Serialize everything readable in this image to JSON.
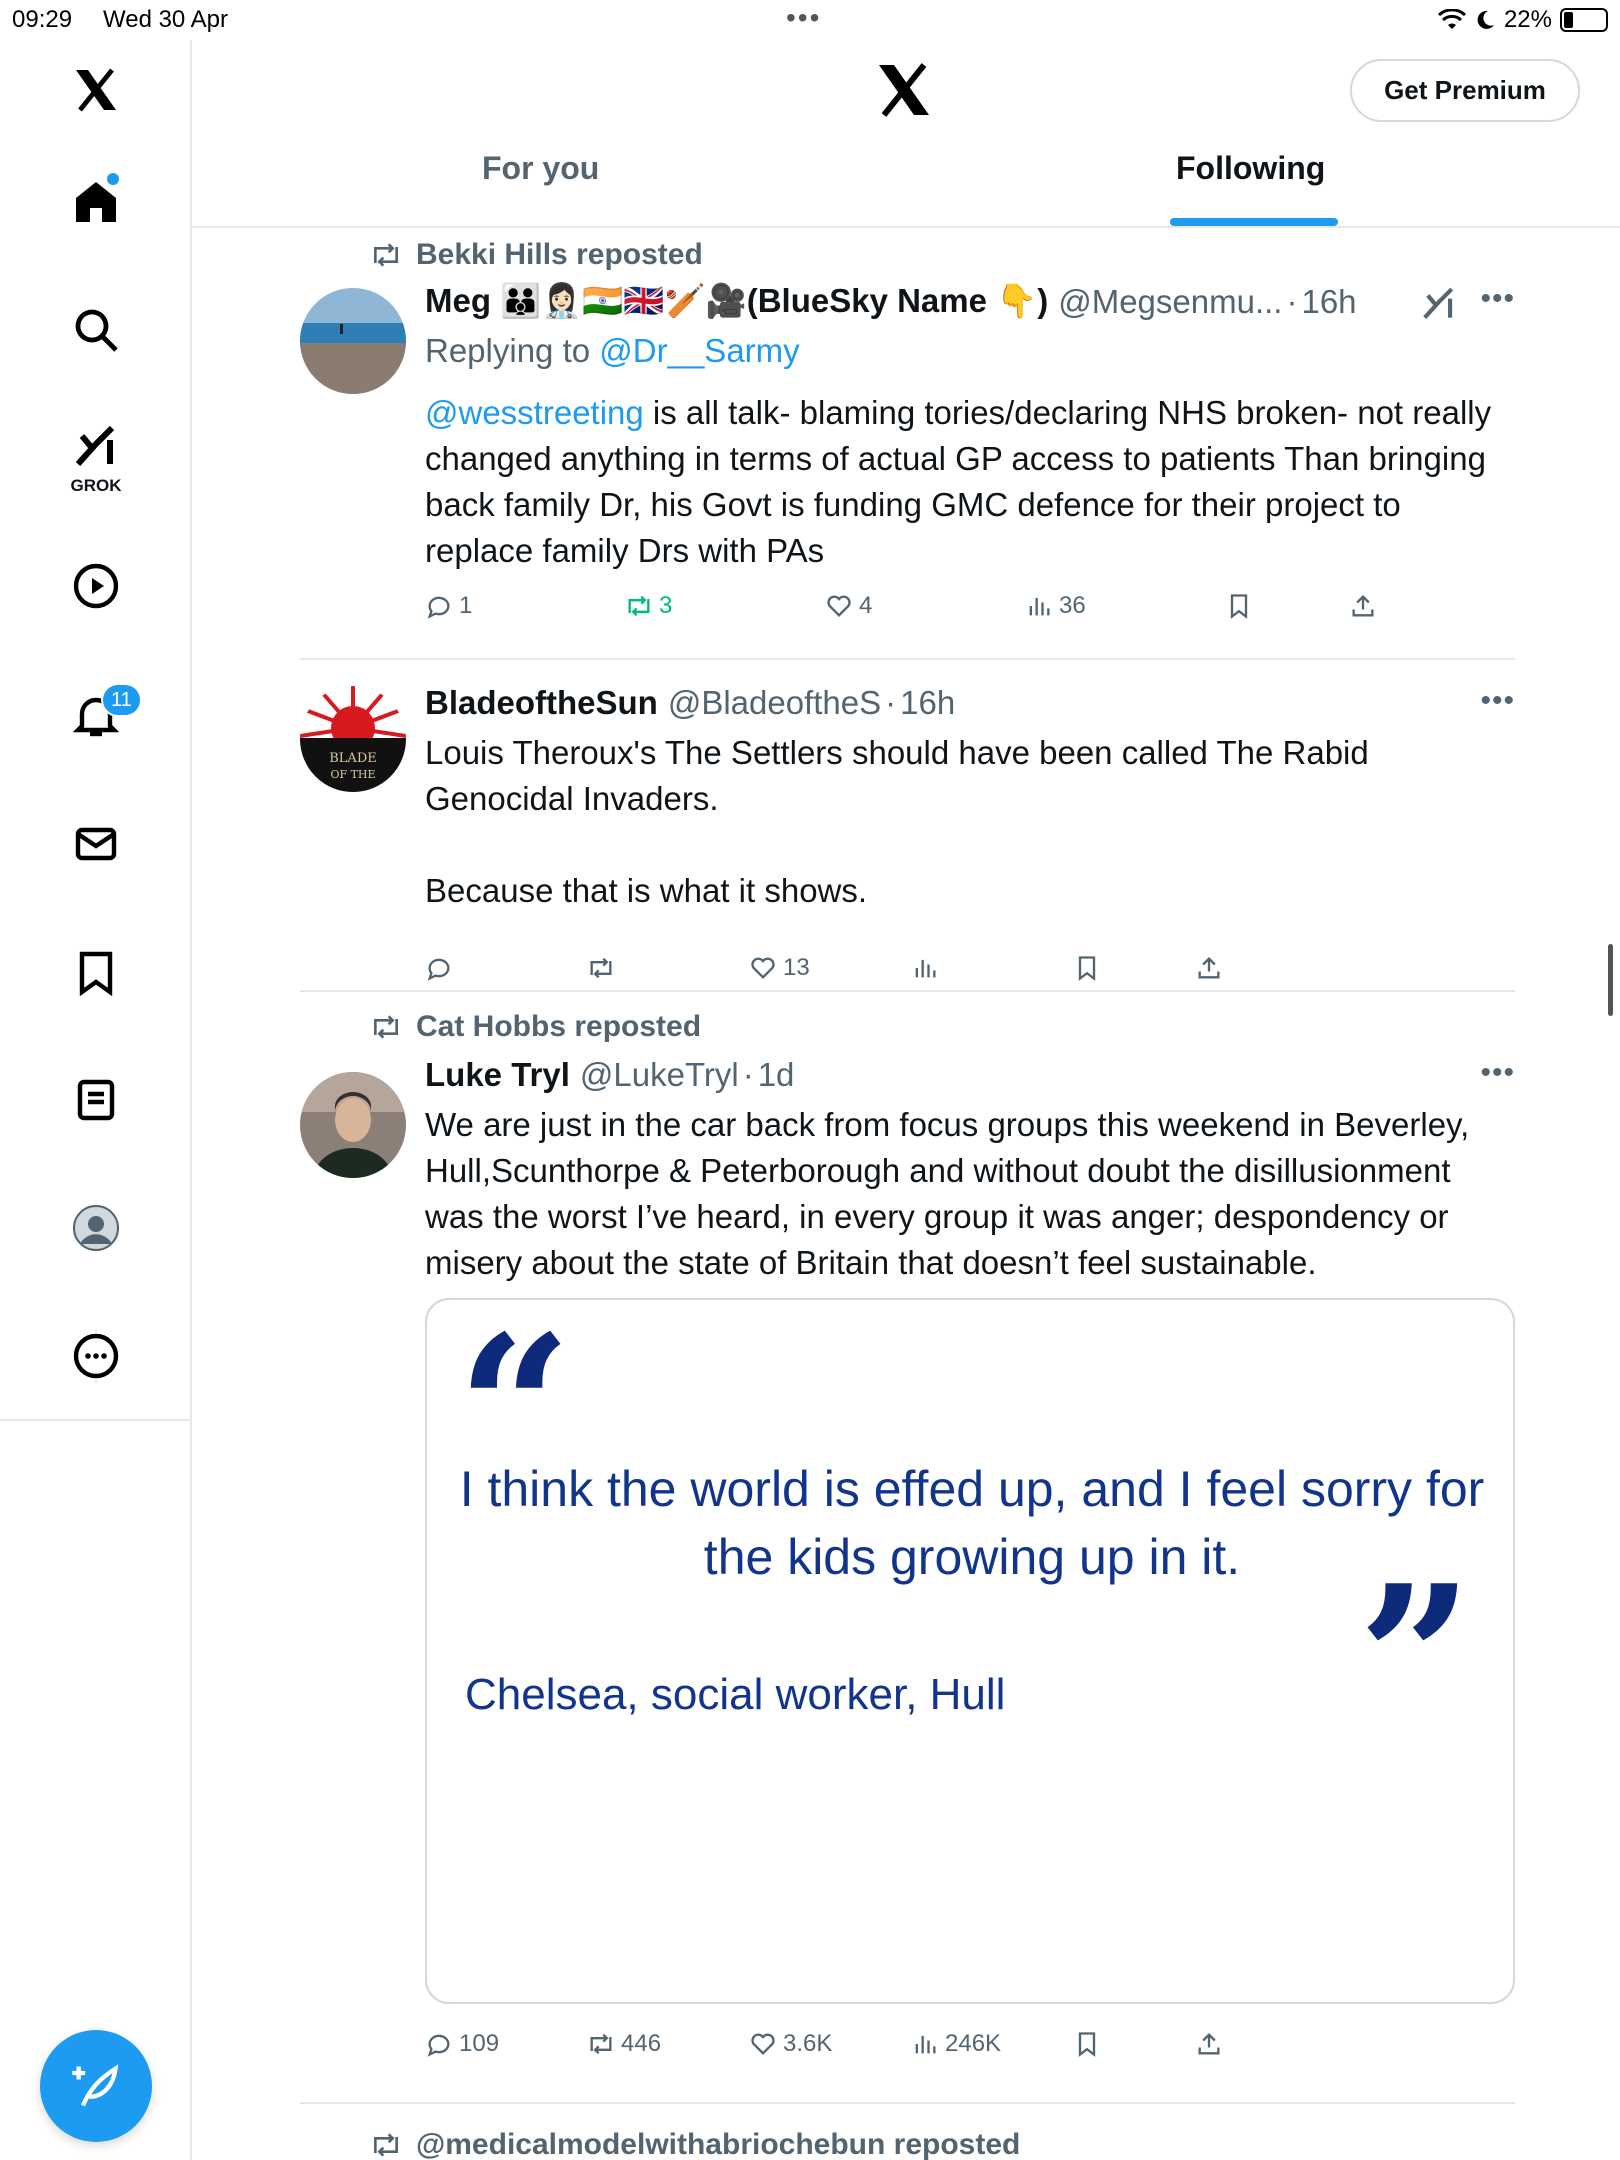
{
  "status_bar": {
    "time": "09:29",
    "date": "Wed 30 Apr",
    "battery": "22%",
    "battery_level": 0.22
  },
  "sidebar": {
    "grok_label": "GROK",
    "notification_count": "11",
    "items": [
      "x-logo",
      "home-icon",
      "search-icon",
      "grok-icon",
      "video-icon",
      "notifications-icon",
      "messages-icon",
      "bookmarks-icon",
      "lists-icon",
      "profile-icon",
      "more-icon"
    ]
  },
  "header": {
    "premium_label": "Get Premium",
    "tabs": [
      {
        "label": "For you",
        "active": false
      },
      {
        "label": "Following",
        "active": true
      }
    ]
  },
  "posts": [
    {
      "repost_by": "Bekki Hills reposted",
      "name": "Meg 🧑‍🧑‍🧒👩🏻‍⚕️🇮🇳🇬🇧🏏🎥(BlueSky Name 👇)",
      "handle": "@Megsenmu...",
      "time": "16h",
      "replying_prefix": "Replying to",
      "replying_to": "@Dr__Sarmy",
      "text_mention": "@wesstreeting",
      "text_rest": " is all talk- blaming tories/declaring NHS broken- not really changed anything in terms of actual GP access to patients Than bringing back family Dr, his Govt is funding GMC defence for their project to replace family Drs with PAs",
      "replies": "1",
      "reposts": "3",
      "likes": "4",
      "views": "36"
    },
    {
      "name": "BladeoftheSun",
      "handle": "@BladeoftheS",
      "time": "16h",
      "avatar_text": "BLADE OF THE",
      "text_1": "Louis Theroux's The Settlers should have been called The Rabid Genocidal Invaders.",
      "text_2": "Because that is what it shows.",
      "replies": "",
      "reposts": "",
      "likes": "13",
      "views": ""
    },
    {
      "repost_by": "Cat Hobbs reposted",
      "name": "Luke Tryl",
      "handle": "@LukeTryl",
      "time": "1d",
      "text": "We are just in the car back from focus groups this weekend in Beverley, Hull,Scunthorpe & Peterborough and without doubt the disillusionment was the worst I’ve heard, in every group it was anger; despondency or misery about the state of Britain that doesn’t feel sustainable.",
      "quote_image": {
        "open_mark": "“",
        "close_mark": "”",
        "quote": "I think the world is effed up, and I feel sorry for the kids growing up in it.",
        "attribution": "Chelsea, social worker, Hull"
      },
      "replies": "109",
      "reposts": "446",
      "likes": "3.6K",
      "views": "246K"
    },
    {
      "repost_by": "@medicalmodelwithabriochebun reposted"
    }
  ],
  "colors": {
    "accent": "#1d9bf0",
    "text": "#0f1419",
    "muted": "#536471",
    "repost_green": "#00ba7c",
    "quote_navy": "#12358c",
    "border": "#e5e7ea"
  }
}
